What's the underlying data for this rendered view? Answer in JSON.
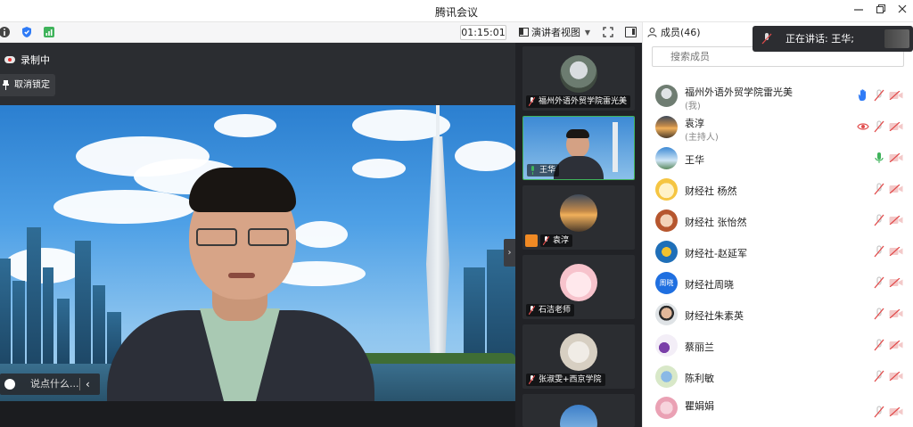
{
  "window": {
    "title": "腾讯会议"
  },
  "toolbar": {
    "timer": "01:15:01",
    "view_label": "演讲者视图"
  },
  "main": {
    "recording_label": "录制中",
    "unpin_label": "取消锁定",
    "chat_placeholder": "说点什么..."
  },
  "thumbnails": [
    {
      "label": "福州外语外贸学院雷光美"
    },
    {
      "label": "王华"
    },
    {
      "label": "袁淳"
    },
    {
      "label": "石洁老师"
    },
    {
      "label": "张淑雯+西京学院"
    }
  ],
  "panel": {
    "header": "成员(46)",
    "search_placeholder": "搜索成员",
    "members": [
      {
        "name": "福州外语外贸学院雷光美",
        "sub": "(我)"
      },
      {
        "name": "袁淳",
        "sub": "(主持人)"
      },
      {
        "name": "王华"
      },
      {
        "name": "财经社 杨然"
      },
      {
        "name": "财经社 张怡然"
      },
      {
        "name": "财经社-赵延军"
      },
      {
        "name": "财经社周晓",
        "avatar_text": "周晓"
      },
      {
        "name": "财经社朱素英"
      },
      {
        "name": "蔡丽兰"
      },
      {
        "name": "陈利敏"
      },
      {
        "name": "瞿娟娟"
      }
    ]
  },
  "toast": {
    "text": "正在讲话: 王华;"
  },
  "colors": {
    "accent_green": "#3fb35b",
    "hand_blue": "#2f7bf6",
    "mute_red": "#e14b4b"
  }
}
